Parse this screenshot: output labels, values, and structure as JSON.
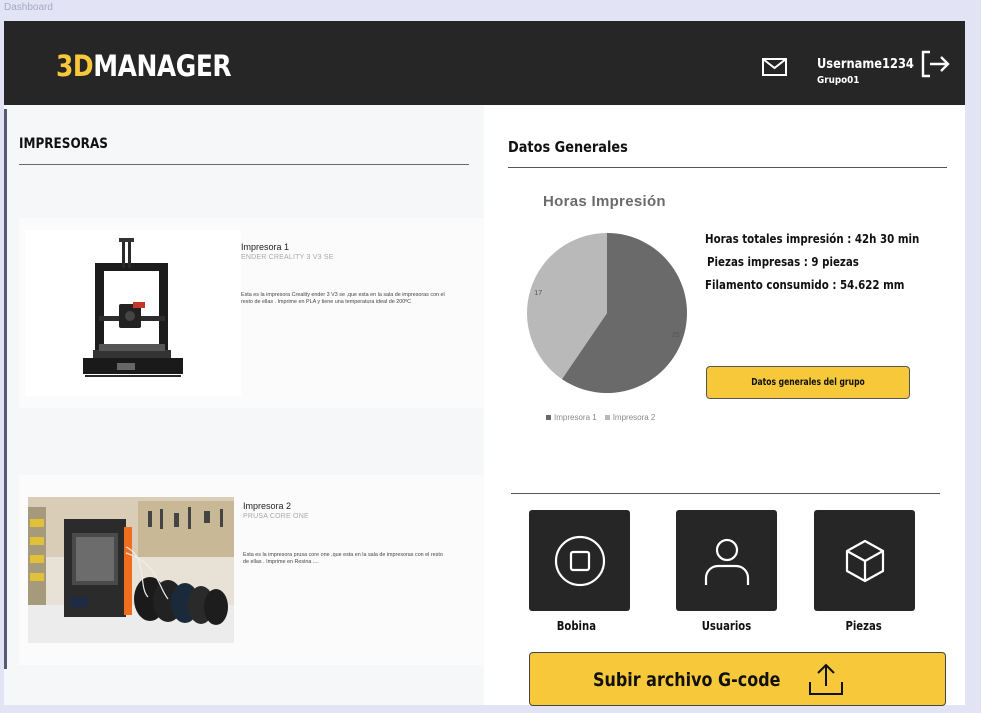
{
  "frame_label": "Dashboard",
  "header": {
    "logo_accent": "3D",
    "logo_rest": "MANAGER",
    "username": "Username1234",
    "group": "Grupo01"
  },
  "left": {
    "title": "IMPRESORAS",
    "printers": [
      {
        "name": "Impresora 1",
        "model": "ENDER CREALITY 3 V3 SE",
        "description": "Esta es la impresora Creality ender 3 V3 se ,que esta en la sala de impresoras con el resto de ellas . Imprime en PLA y tiene una temperatura ideal de 200ºC"
      },
      {
        "name": "Impresora 2",
        "model": "PRUSA CORE ONE",
        "description": "Esta es la impresora prusa core one ,que esta en la sala de impresoras con el resto de ellas . Imprime en Resina ...."
      }
    ]
  },
  "right": {
    "title": "Datos Generales",
    "chart_title": "Horas Impresión",
    "stats": [
      "Horas totales impresión : 42h 30 min",
      "Piezas impresas : 9 piezas",
      "Filamento consumido : 54.622 mm"
    ],
    "group_button": "Datos generales del grupo",
    "tiles": [
      {
        "label": "Bobina",
        "icon": "stop-circle-icon"
      },
      {
        "label": "Usuarios",
        "icon": "user-icon"
      },
      {
        "label": "Piezas",
        "icon": "cube-icon"
      }
    ],
    "upload_button": "Subir archivo G-code"
  },
  "chart_data": {
    "type": "pie",
    "title": "Horas Impresión",
    "categories": [
      "Impresora 1",
      "Impresora 2"
    ],
    "values": [
      25,
      17
    ],
    "colors": [
      "#6a6a6a",
      "#b9b9b9"
    ],
    "legend": "bottom"
  },
  "colors": {
    "header_bg": "#262626",
    "accent_yellow": "#f6c83a",
    "page_bg": "#e2e3f4"
  }
}
